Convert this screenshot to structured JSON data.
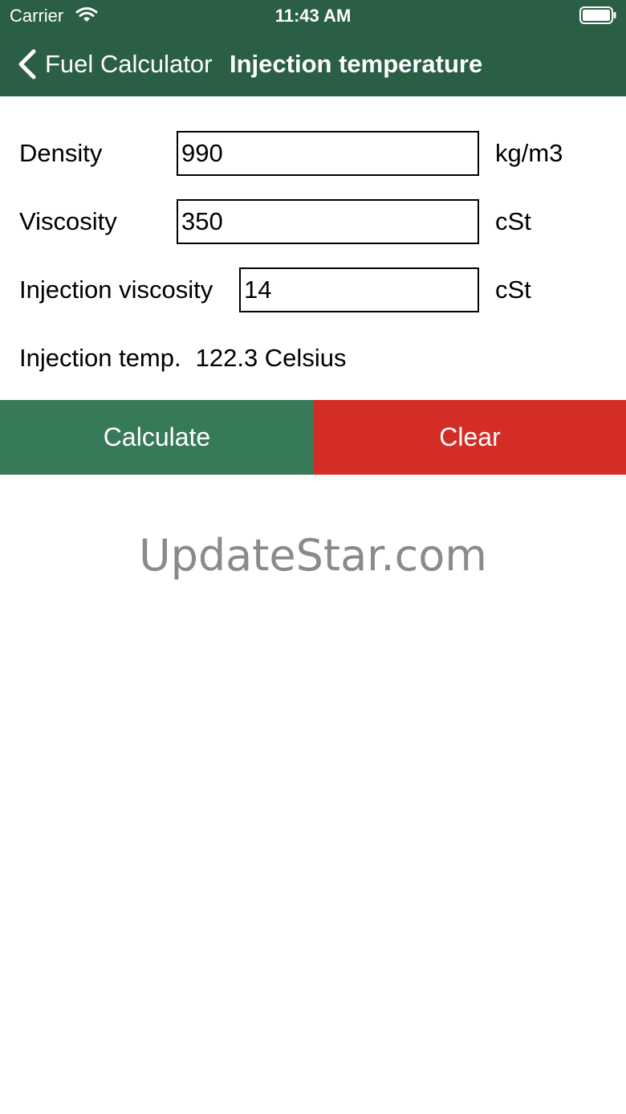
{
  "status_bar": {
    "carrier": "Carrier",
    "time": "11:43 AM",
    "wifi_icon": "wifi-icon",
    "battery_icon": "battery-full-icon"
  },
  "nav": {
    "back_label": "Fuel Calculator",
    "back_icon": "chevron-left-icon",
    "title": "Injection temperature",
    "background_color": "#2a5e45"
  },
  "form": {
    "density": {
      "label": "Density",
      "value": "990",
      "unit": "kg/m3"
    },
    "viscosity": {
      "label": "Viscosity",
      "value": "350",
      "unit": "cSt"
    },
    "injection_viscosity": {
      "label": "Injection viscosity",
      "value": "14",
      "unit": "cSt"
    }
  },
  "result": {
    "label": "Injection temp.",
    "value": "122.3 Celsius"
  },
  "buttons": {
    "calculate": {
      "label": "Calculate",
      "color": "#377a58"
    },
    "clear": {
      "label": "Clear",
      "color": "#d42d25"
    }
  },
  "watermark": "UpdateStar.com"
}
